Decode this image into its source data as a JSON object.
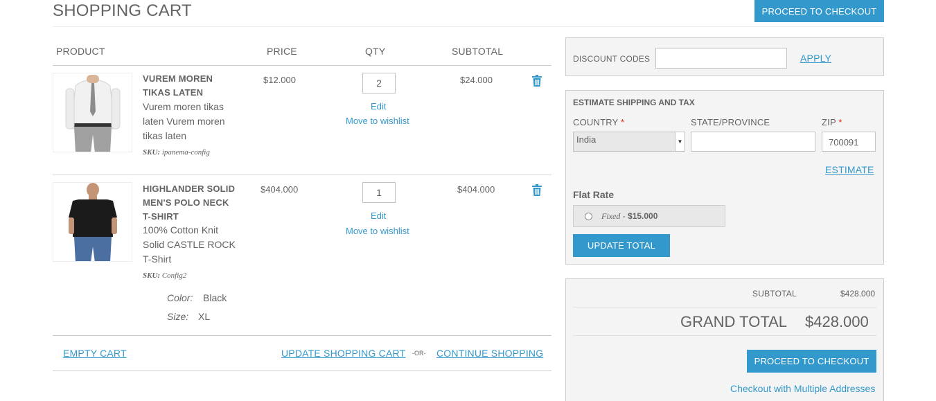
{
  "header": {
    "title": "SHOPPING CART",
    "checkout_top": "PROCEED TO CHECKOUT"
  },
  "table": {
    "columns": [
      "PRODUCT",
      "PRICE",
      "QTY",
      "SUBTOTAL"
    ]
  },
  "items": [
    {
      "name_lines": [
        "VUREM MOREN",
        "TIKAS LATEN"
      ],
      "desc_lines": [
        "Vurem moren tikas",
        "laten Vurem moren",
        "tikas laten"
      ],
      "sku_label": "SKU:",
      "sku": "ipanema-config",
      "price": "$12.000",
      "qty": "2",
      "edit": "Edit",
      "wishlist": "Move to wishlist",
      "subtotal": "$24.000",
      "remove_icon": "trash-icon",
      "options": []
    },
    {
      "name_lines": [
        "HIGHLANDER SOLID",
        "MEN'S POLO NECK",
        "T-SHIRT"
      ],
      "desc_lines": [
        "100% Cotton Knit",
        "Solid CASTLE ROCK",
        "T-Shirt"
      ],
      "sku_label": "SKU:",
      "sku": "Config2",
      "price": "$404.000",
      "qty": "1",
      "edit": "Edit",
      "wishlist": "Move to wishlist",
      "subtotal": "$404.000",
      "remove_icon": "trash-icon",
      "options": [
        {
          "label": "Color:",
          "value": "Black"
        },
        {
          "label": "Size:",
          "value": "XL"
        }
      ]
    }
  ],
  "cart_actions": {
    "empty": "EMPTY CART",
    "update": "UPDATE SHOPPING CART",
    "or": "-OR-",
    "continue": "CONTINUE SHOPPING"
  },
  "discount": {
    "label": "DISCOUNT CODES",
    "value": "",
    "apply": "APPLY"
  },
  "shipping": {
    "title": "ESTIMATE SHIPPING AND TAX",
    "country_label": "COUNTRY",
    "country_value": "India",
    "state_label": "STATE/PROVINCE",
    "state_value": "",
    "zip_label": "ZIP",
    "zip_value": "700091",
    "required_mark": "*",
    "estimate": "ESTIMATE",
    "rate_title": "Flat Rate",
    "rate_method": "Fixed",
    "rate_sep": "-",
    "rate_price": "$15.000",
    "update_total": "UPDATE TOTAL"
  },
  "totals": {
    "subtotal_label": "SUBTOTAL",
    "subtotal_value": "$428.000",
    "grand_label": "GRAND TOTAL",
    "grand_value": "$428.000",
    "checkout": "PROCEED TO CHECKOUT",
    "multi": "Checkout with Multiple Addresses"
  },
  "colors": {
    "accent": "#3399cc",
    "text": "#636363",
    "required": "#df280a"
  }
}
